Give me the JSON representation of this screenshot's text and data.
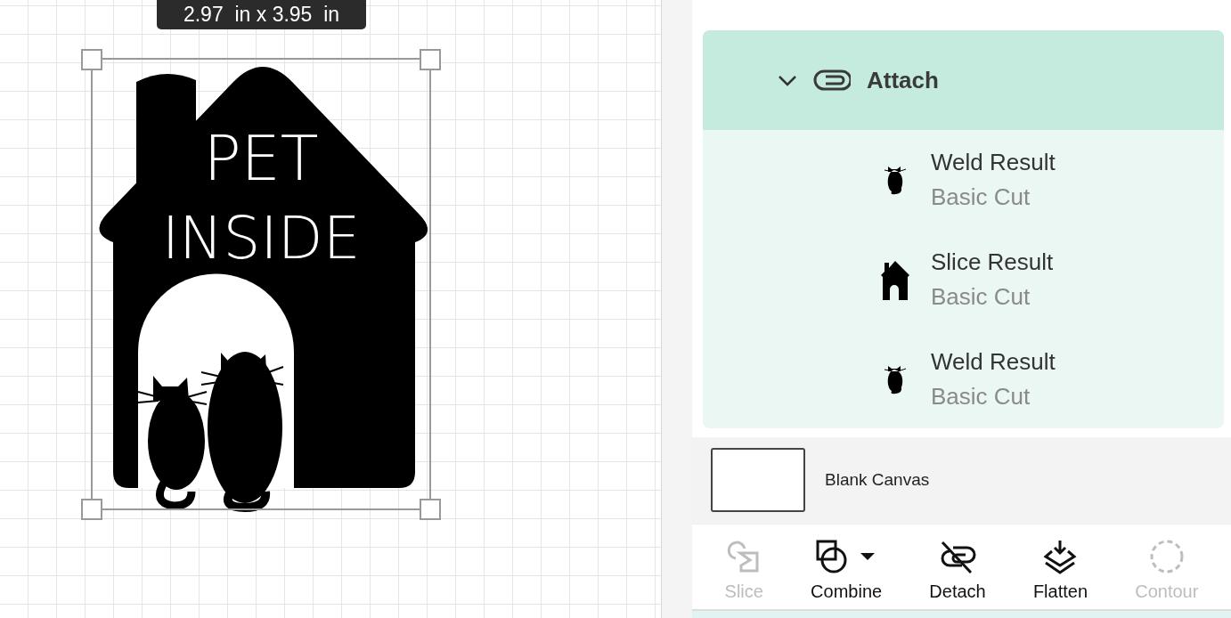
{
  "canvas": {
    "size_label": "2.97  in x 3.95  in",
    "design_lines": [
      "PET",
      "INSIDE"
    ]
  },
  "layers": {
    "group": {
      "title": "Attach",
      "expanded": true,
      "children": [
        {
          "name": "Weld Result",
          "operation": "Basic Cut",
          "kind": "cat"
        },
        {
          "name": "Slice Result",
          "operation": "Basic Cut",
          "kind": "house"
        },
        {
          "name": "Weld Result",
          "operation": "Basic Cut",
          "kind": "cat"
        }
      ]
    },
    "canvas_item": {
      "name": "Blank Canvas"
    }
  },
  "toolbar": [
    {
      "label": "Slice",
      "kind": "slice",
      "disabled": true
    },
    {
      "label": "Combine",
      "kind": "combine",
      "disabled": false
    },
    {
      "label": "Detach",
      "kind": "detach",
      "disabled": false
    },
    {
      "label": "Flatten",
      "kind": "flatten",
      "disabled": false
    },
    {
      "label": "Contour",
      "kind": "contour",
      "disabled": true
    }
  ]
}
